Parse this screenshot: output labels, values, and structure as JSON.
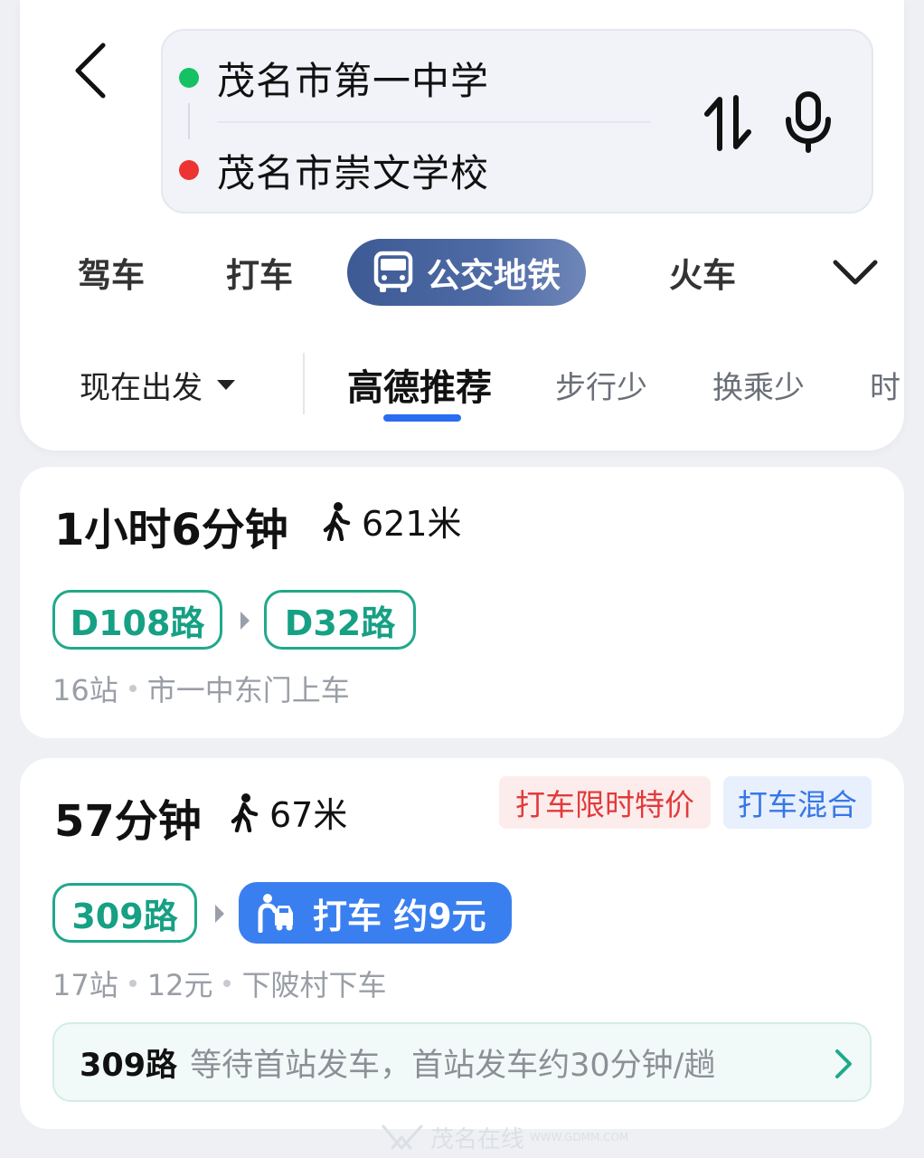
{
  "route": {
    "from": "茂名市第一中学",
    "to": "茂名市崇文学校"
  },
  "mode_tabs": [
    {
      "label": "驾车"
    },
    {
      "label": "打车"
    },
    {
      "label": "公交地铁"
    },
    {
      "label": "火车"
    }
  ],
  "preferences": {
    "depart_label": "现在出发",
    "tabs": [
      {
        "label": "高德推荐"
      },
      {
        "label": "步行少"
      },
      {
        "label": "换乘少"
      },
      {
        "label": "时"
      }
    ]
  },
  "results": [
    {
      "duration": "1小时6分钟",
      "walk": "621米",
      "lines": [
        "D108路",
        "D32路"
      ],
      "meta": [
        "16站",
        "市一中东门上车"
      ]
    },
    {
      "duration": "57分钟",
      "walk": "67米",
      "tags": [
        "打车限时特价",
        "打车混合"
      ],
      "lines": [
        "309路"
      ],
      "taxi": "打车 约9元",
      "meta": [
        "17站",
        "12元",
        "下陂村下车"
      ],
      "notice": {
        "route": "309路",
        "message": "等待首站发车，首站发车约30分钟/趟"
      }
    }
  ],
  "watermark": {
    "text": "茂名在线",
    "url": "WWW.GDMM.COM"
  },
  "colors": {
    "active_tab_bg": "#4a63a0",
    "line_chip": "#20a98a",
    "taxi_chip": "#3a7ff0",
    "underline": "#2b6df1",
    "dot_origin": "#16c163",
    "dot_destination": "#ee3333"
  }
}
